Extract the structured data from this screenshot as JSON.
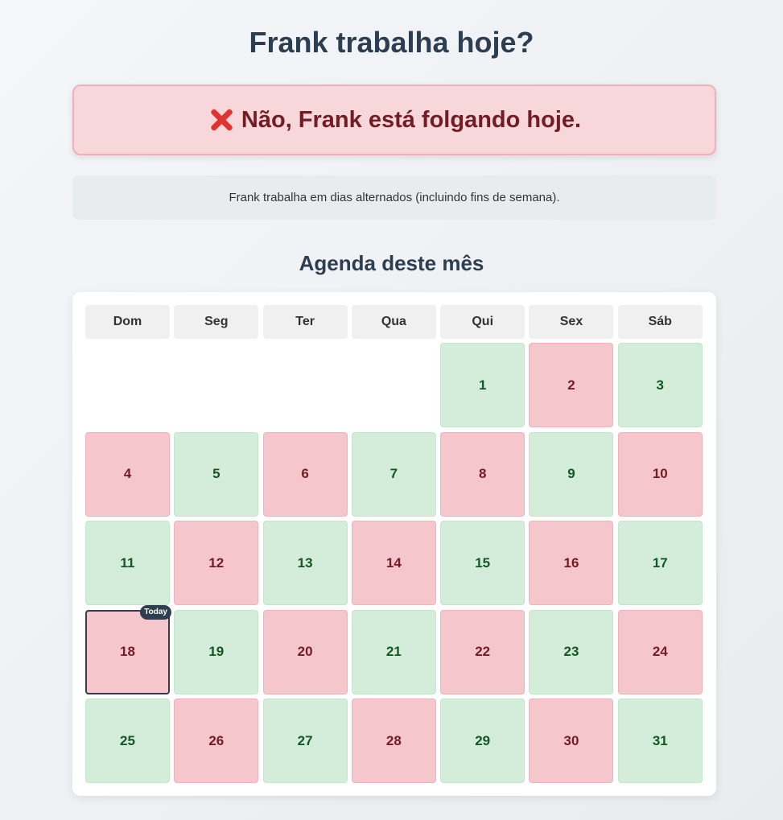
{
  "page": {
    "title": "Frank trabalha hoje?",
    "status_message": "Não, Frank está folgando hoje.",
    "status_icon": "x-mark-icon",
    "info_text": "Frank trabalha em dias alternados (incluindo fins de semana).",
    "schedule_title": "Agenda deste mês"
  },
  "calendar": {
    "weekdays": [
      "Dom",
      "Seg",
      "Ter",
      "Qua",
      "Qui",
      "Sex",
      "Sáb"
    ],
    "leading_blanks": 4,
    "today": 18,
    "today_label": "Today",
    "days": [
      {
        "day": "1",
        "status": "work"
      },
      {
        "day": "2",
        "status": "off"
      },
      {
        "day": "3",
        "status": "work"
      },
      {
        "day": "4",
        "status": "off"
      },
      {
        "day": "5",
        "status": "work"
      },
      {
        "day": "6",
        "status": "off"
      },
      {
        "day": "7",
        "status": "work"
      },
      {
        "day": "8",
        "status": "off"
      },
      {
        "day": "9",
        "status": "work"
      },
      {
        "day": "10",
        "status": "off"
      },
      {
        "day": "11",
        "status": "work"
      },
      {
        "day": "12",
        "status": "off"
      },
      {
        "day": "13",
        "status": "work"
      },
      {
        "day": "14",
        "status": "off"
      },
      {
        "day": "15",
        "status": "work"
      },
      {
        "day": "16",
        "status": "off"
      },
      {
        "day": "17",
        "status": "work"
      },
      {
        "day": "18",
        "status": "off"
      },
      {
        "day": "19",
        "status": "work"
      },
      {
        "day": "20",
        "status": "off"
      },
      {
        "day": "21",
        "status": "work"
      },
      {
        "day": "22",
        "status": "off"
      },
      {
        "day": "23",
        "status": "work"
      },
      {
        "day": "24",
        "status": "off"
      },
      {
        "day": "25",
        "status": "work"
      },
      {
        "day": "26",
        "status": "off"
      },
      {
        "day": "27",
        "status": "work"
      },
      {
        "day": "28",
        "status": "off"
      },
      {
        "day": "29",
        "status": "work"
      },
      {
        "day": "30",
        "status": "off"
      },
      {
        "day": "31",
        "status": "work"
      }
    ]
  },
  "colors": {
    "work_bg": "#d4edda",
    "off_bg": "#f5c6cb",
    "status_bg": "#f8d7da",
    "heading": "#2c3e50"
  }
}
